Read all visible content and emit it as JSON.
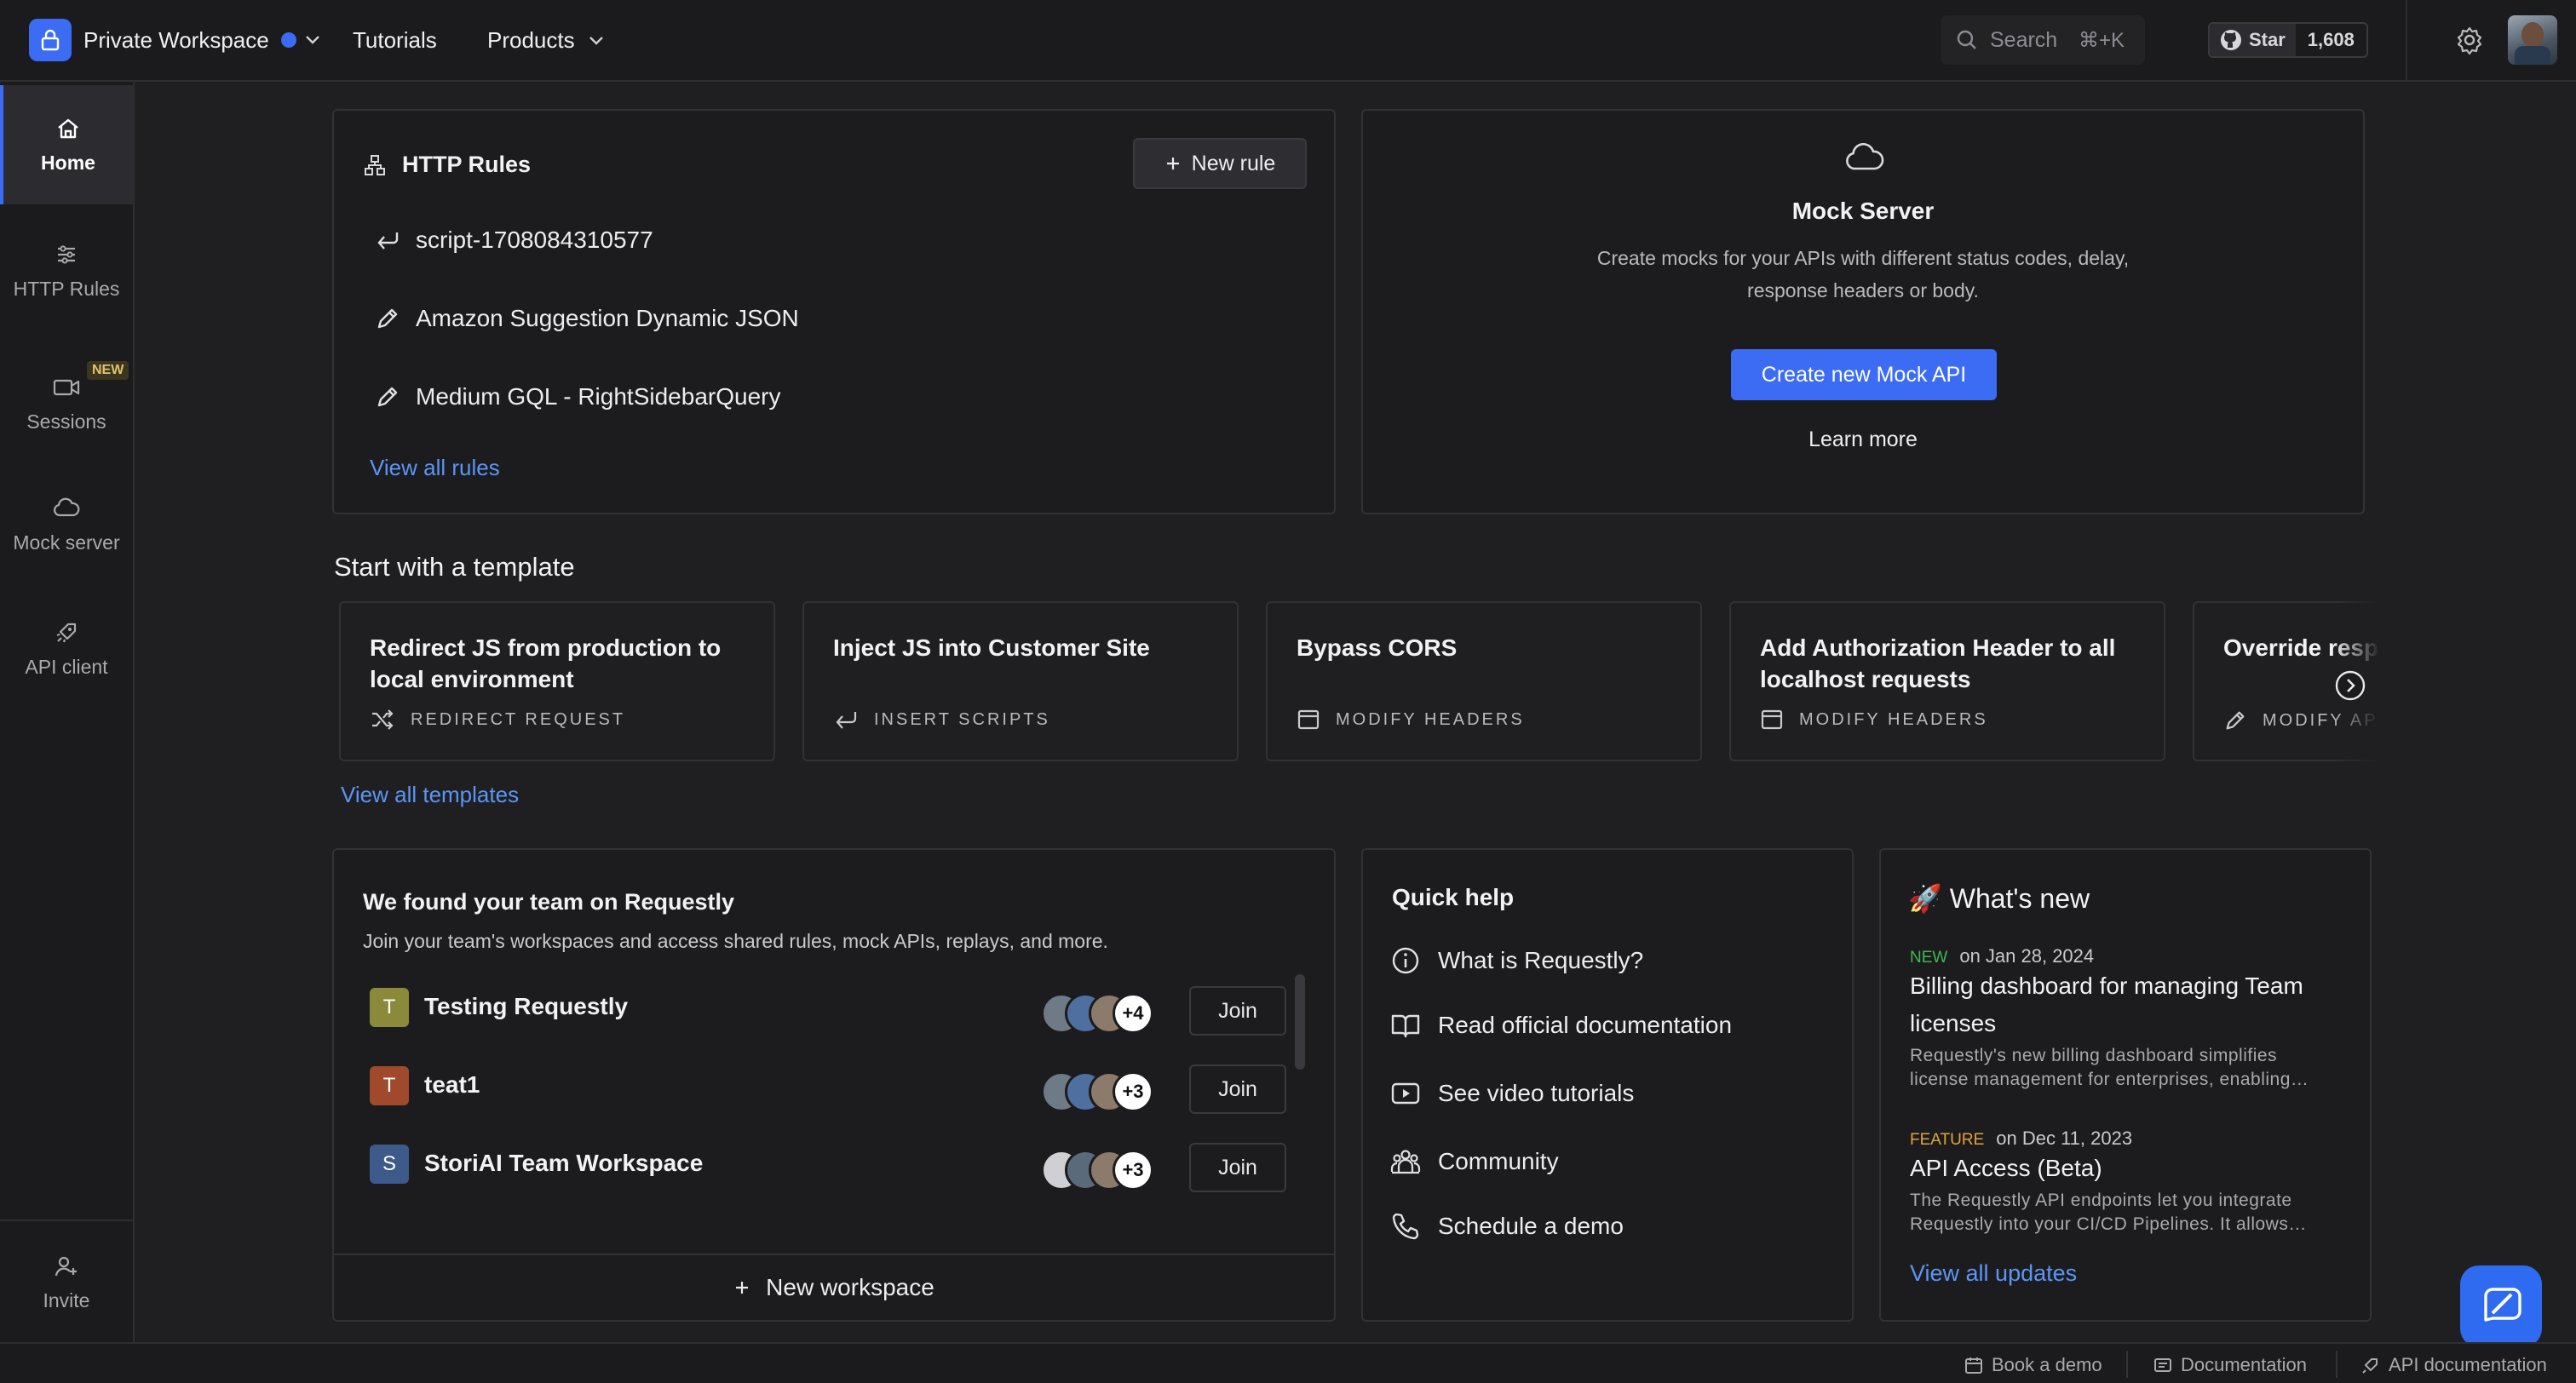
{
  "topbar": {
    "workspace_name": "Private Workspace",
    "nav": [
      "Tutorials",
      "Products"
    ],
    "search_placeholder": "Search",
    "search_shortcut": "⌘+K",
    "github_star_label": "Star",
    "github_star_count": "1,608"
  },
  "sidebar": {
    "items": [
      {
        "label": "Home",
        "icon": "home-icon"
      },
      {
        "label": "HTTP Rules",
        "icon": "sliders-icon"
      },
      {
        "label": "Sessions",
        "icon": "video-icon",
        "badge": "NEW"
      },
      {
        "label": "Mock server",
        "icon": "cloud-icon"
      },
      {
        "label": "API client",
        "icon": "rocket-icon"
      }
    ],
    "invite_label": "Invite"
  },
  "http_rules": {
    "title": "HTTP Rules",
    "new_rule_label": "New rule",
    "rules": [
      {
        "name": "script-1708084310577",
        "icon": "insert-script-icon"
      },
      {
        "name": "Amazon Suggestion Dynamic JSON",
        "icon": "pencil-icon"
      },
      {
        "name": "Medium GQL - RightSidebarQuery",
        "icon": "pencil-icon"
      }
    ],
    "view_all_label": "View all rules"
  },
  "mock_server": {
    "title": "Mock Server",
    "description_line1": "Create mocks for your APIs with different status codes, delay,",
    "description_line2": "response headers or body.",
    "create_label": "Create new Mock API",
    "learn_more_label": "Learn more"
  },
  "templates": {
    "heading": "Start with a template",
    "items": [
      {
        "title": "Redirect JS from production to local environment",
        "tag": "REDIRECT REQUEST"
      },
      {
        "title": "Inject JS into Customer Site",
        "tag": "INSERT SCRIPTS"
      },
      {
        "title": "Bypass CORS",
        "tag": "MODIFY HEADERS"
      },
      {
        "title": "Add Authorization Header to all localhost requests",
        "tag": "MODIFY HEADERS"
      },
      {
        "title": "Override resp",
        "tag": "MODIFY AP"
      }
    ],
    "view_all_label": "View all templates"
  },
  "team": {
    "title": "We found your team on Requestly",
    "subtitle": "Join your team's workspaces and access shared rules, mock APIs, replays, and more.",
    "workspaces": [
      {
        "initial": "T",
        "name": "Testing Requestly",
        "extra": "+4",
        "join": "Join",
        "color": "#8a8a3a"
      },
      {
        "initial": "T",
        "name": "teat1",
        "extra": "+3",
        "join": "Join",
        "color": "#a0492c"
      },
      {
        "initial": "S",
        "name": "StoriAI Team Workspace",
        "extra": "+3",
        "join": "Join",
        "color": "#3d5a8a"
      }
    ],
    "new_workspace_label": "New workspace"
  },
  "quick_help": {
    "title": "Quick help",
    "items": [
      {
        "label": "What is Requestly?",
        "icon": "info-icon"
      },
      {
        "label": "Read official documentation",
        "icon": "book-icon"
      },
      {
        "label": "See video tutorials",
        "icon": "play-icon"
      },
      {
        "label": "Community",
        "icon": "community-icon"
      },
      {
        "label": "Schedule a demo",
        "icon": "phone-icon"
      }
    ]
  },
  "whats_new": {
    "title": "🚀 What's new",
    "updates": [
      {
        "tag": "NEW",
        "date": "on Jan 28, 2024",
        "headline_line1": "Billing dashboard for managing Team",
        "headline_line2": "licenses",
        "desc_line1": "Requestly's new billing dashboard simplifies",
        "desc_line2": "license management for enterprises, enabling…"
      },
      {
        "tag": "FEATURE",
        "date": "on Dec 11, 2023",
        "headline_line1": "API Access (Beta)",
        "desc_line1": "The Requestly API endpoints let you integrate",
        "desc_line2": "Requestly into your CI/CD Pipelines. It allows…"
      }
    ],
    "view_all_label": "View all updates"
  },
  "footer": {
    "items": [
      {
        "label": "Book a demo",
        "icon": "calendar-icon"
      },
      {
        "label": "Documentation",
        "icon": "docs-icon"
      },
      {
        "label": "API documentation",
        "icon": "api-icon"
      }
    ]
  },
  "colors": {
    "accent": "#3b6cf3",
    "link": "#5b95f5",
    "new_tag": "#3fb950",
    "feature_tag": "#e3a33a"
  }
}
